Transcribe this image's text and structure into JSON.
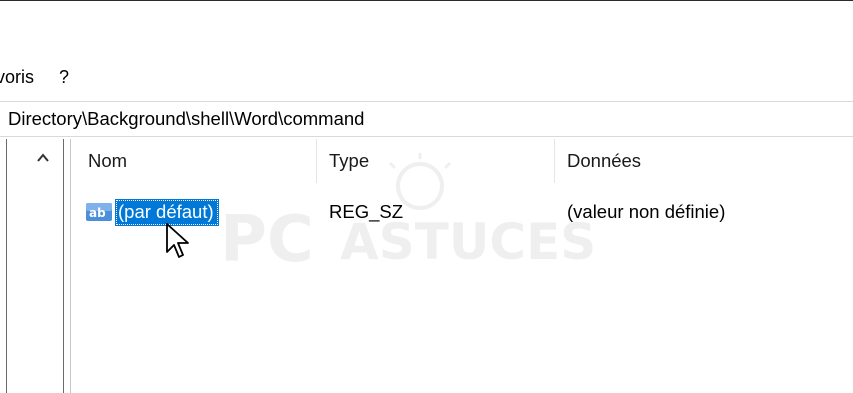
{
  "menubar": {
    "items": [
      "voris",
      "?"
    ]
  },
  "address": {
    "path": "Directory\\Background\\shell\\Word\\command"
  },
  "list": {
    "columns": [
      "Nom",
      "Type",
      "Données"
    ],
    "rows": [
      {
        "name": "(par défaut)",
        "type": "REG_SZ",
        "data": "(valeur non définie)",
        "icon": "string-value-icon"
      }
    ]
  },
  "icons": {
    "tree_scroll": "chevron-up-icon",
    "cursor": "mouse-pointer-icon"
  },
  "colors": {
    "selection": "#0078d7",
    "selection_text": "#ffffff",
    "icon_ab": "#3b7fd0"
  },
  "watermark": {
    "text": "PC ASTUCES"
  }
}
